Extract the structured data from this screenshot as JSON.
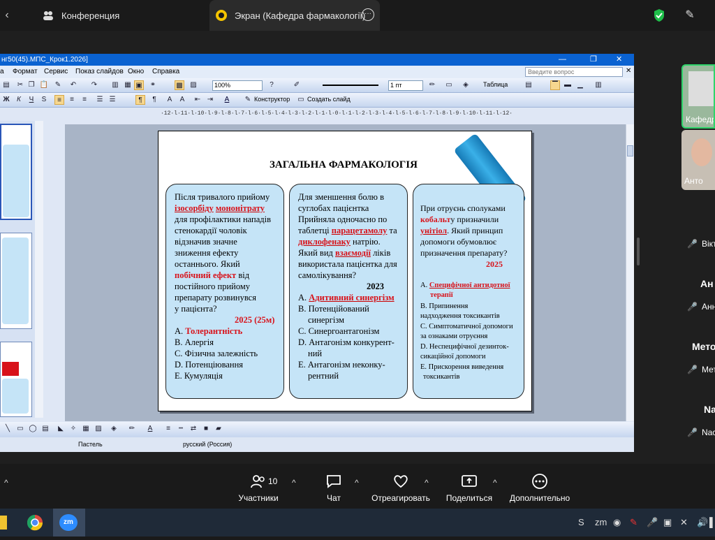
{
  "zoom_tabs": [
    {
      "label": "Конференция"
    },
    {
      "label": "Экран (Кафедра фармакології)"
    }
  ],
  "ppt": {
    "title": "нг50(45).МПС_Крок1.2026]",
    "menu": [
      "а",
      "Формат",
      "Сервис",
      "Показ слайдов",
      "Окно",
      "Справка"
    ],
    "ask_placeholder": "Введите вопрос",
    "zoom": "100%",
    "line_width": "1 пт",
    "table_label": "Таблица",
    "designer_label": "Конструктор",
    "new_slide_label": "Создать слайд",
    "ruler_h": "·12·l·11·l·10·l·9·l·8·l·7·l·6·l·5·l·4·l·3·l·2·l·1·l·0·l·1·l·2·l·3·l·4·l·5·l·6·l·7·l·8·l·9·l·10·l·11·l·12·",
    "status_design": "Пастель",
    "status_lang": "русский (Россия)"
  },
  "slide": {
    "title": "ЗАГАЛЬНА ФАРМАКОЛОГІЯ",
    "card1": {
      "l1": "Після тривалого прийому",
      "l2a": "ізосорбіду",
      "l2b": " ",
      "l2c": "мононітрату",
      "l3": "для профілактики нападів",
      "l4": "стенокардії чоловік",
      "l5": "відзначив значне",
      "l6": "зниження ефекту",
      "l7": "останнього. Який",
      "l8a": "побічний ефект",
      "l8b": " від",
      "l9": "постійного прийому",
      "l10": "препарату розвинувся",
      "l11": "у пацієнта?",
      "year": "2025 (25м)",
      "a_prefix": "A. ",
      "a": "Толерантність",
      "b": "B. Алергія",
      "c": "C. Фізична залежність",
      "d": "D. Потенціювання",
      "e": "E. Кумуляція"
    },
    "card2": {
      "l1": "Для зменшення болю в",
      "l2": "суглобах пацієнтка",
      "l3": "Прийняла одночасно по",
      "l4a": "таблетці ",
      "l4b": "парацетамолу",
      "l4c": " та",
      "l5a": "диклофенаку",
      "l5b": " натрію.",
      "l6a": "Який вид ",
      "l6b": "взаємодії",
      "l6c": " ліків",
      "l7": "використала пацієнтка для",
      "l8": "самолікування?",
      "year": "2023",
      "a_prefix": "A. ",
      "a": "Адитивний синергізм",
      "b1": "B. Потенційований",
      "b2": "синергізм",
      "c": "C. Синергоантагонізм",
      "d1": "D. Антагонізм конкурент-",
      "d2": "ний",
      "e1": "E. Антагонізм неконку-",
      "e2": "рентний"
    },
    "card3": {
      "l1": "При отруєнь сполуками",
      "l2a": "кобальт",
      "l2b": "у призначили",
      "l3a": "унітіол",
      "l3b": ". Який принцип",
      "l4": "допомоги обумовлює",
      "l5": "призначення препарату?",
      "year": "2025",
      "a_prefix": "A. ",
      "a1": "Специфічної антидотної",
      "a2": "терапії",
      "b1": "B. Припинення",
      "b2": "надходження токсикантів",
      "c1": "C. Симптоматичної допомоги",
      "c2": "за ознаками отруєння",
      "d1": "D. Неспецифічної дезинток-",
      "d2": "сикаційної допомоги",
      "e1": "E. Прискорення виведення",
      "e2": "токсикантів"
    }
  },
  "participants": {
    "p1": "Кафедр",
    "p2": "Анто",
    "p3": "Вікт",
    "big1": "Ан",
    "p4": "Анна",
    "big2": "Мето",
    "p5": "Мет",
    "big3": "Na",
    "p6": "Nac"
  },
  "bottom_bar": {
    "participants_count": "10",
    "participants": "Участники",
    "chat": "Чат",
    "react": "Отреагировать",
    "share": "Поделиться",
    "more": "Дополнительно"
  },
  "colors": {
    "accent_red": "#d8121a",
    "card_bg": "#c5e4f7",
    "title_blue": "#0a62d1"
  }
}
